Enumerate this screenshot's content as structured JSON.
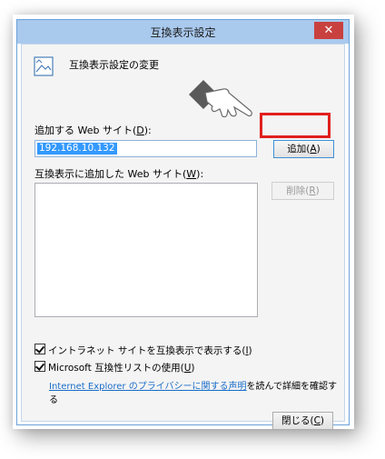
{
  "window": {
    "title": "互換表示設定",
    "close_glyph": "✕"
  },
  "header": {
    "text": "互換表示設定の変更",
    "icon": "image-icon"
  },
  "add_site": {
    "label_prefix": "追加する Web サイト(",
    "label_key": "D",
    "label_suffix": "):",
    "input_value": "192.168.10.132",
    "add_button_prefix": "追加(",
    "add_button_key": "A",
    "add_button_suffix": ")"
  },
  "site_list": {
    "label_prefix": "互換表示に追加した Web サイト(",
    "label_key": "W",
    "label_suffix": "):",
    "remove_button_prefix": "削除(",
    "remove_button_key": "R",
    "remove_button_suffix": ")"
  },
  "options": {
    "intranet_prefix": "イントラネット サイトを互換表示で表示する(",
    "intranet_key": "I",
    "intranet_suffix": ")",
    "intranet_checked": true,
    "mslist_prefix": "Microsoft 互換性リストの使用(",
    "mslist_key": "U",
    "mslist_suffix": ")",
    "mslist_checked": true
  },
  "privacy": {
    "link_text": "Internet Explorer のプライバシーに関する声明",
    "suffix_text": "を読んで詳細を確認する"
  },
  "footer": {
    "close_prefix": "閉じる(",
    "close_key": "C",
    "close_suffix": ")"
  },
  "colors": {
    "titlebar": "#a9c9ed",
    "close_button": "#c8413f",
    "highlight_box": "#e0201d",
    "selection": "#3399ff",
    "link": "#1a6dc9"
  },
  "annotation": {
    "pointer": "pointing-hand-icon"
  }
}
